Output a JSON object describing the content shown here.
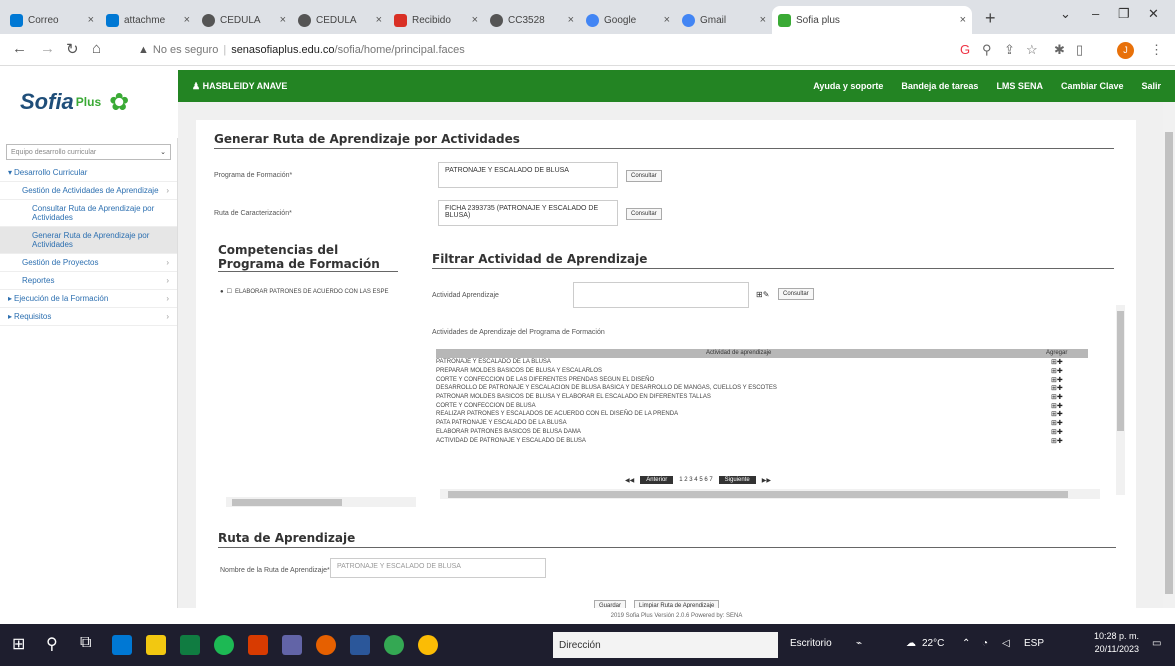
{
  "browser": {
    "tabs": [
      {
        "label": "Correo",
        "favicon_color": "#0078d4"
      },
      {
        "label": "attachme",
        "favicon_color": "#0078d4"
      },
      {
        "label": "CEDULA",
        "favicon_color": "#555555"
      },
      {
        "label": "CEDULA",
        "favicon_color": "#555555"
      },
      {
        "label": "Recibido",
        "favicon_color": "#d93025"
      },
      {
        "label": "CC3528",
        "favicon_color": "#555555"
      },
      {
        "label": "Google",
        "favicon_color": "#4285f4"
      },
      {
        "label": "Gmail",
        "favicon_color": "#4285f4"
      },
      {
        "label": "Sofia plus",
        "favicon_color": "#3aaa35"
      }
    ],
    "url_prefix": "No es seguro",
    "url_host": "senasofiaplus.edu.co",
    "url_path": "/sofia/home/principal.faces",
    "profile_initial": "J"
  },
  "header": {
    "logo_text": "Sofia",
    "logo_plus": "Plus",
    "user_name": "HASBLEIDY ANAVE",
    "links": [
      "Ayuda y soporte",
      "Bandeja de tareas",
      "LMS SENA",
      "Cambiar Clave",
      "Salir"
    ]
  },
  "sidebar": {
    "role_placeholder": "Equipo desarrollo curricular",
    "items": [
      {
        "label": "Desarrollo Curricular",
        "level": 0
      },
      {
        "label": "Gestión de Actividades de Aprendizaje",
        "level": 1
      },
      {
        "label": "Consultar Ruta de Aprendizaje por Actividades",
        "level": 2
      },
      {
        "label": "Generar Ruta de Aprendizaje por Actividades",
        "level": 2
      },
      {
        "label": "Gestión de Proyectos",
        "level": 1
      },
      {
        "label": "Reportes",
        "level": 1
      },
      {
        "label": "Ejecución de la Formación",
        "level": 0
      },
      {
        "label": "Requisitos",
        "level": 0
      }
    ]
  },
  "form": {
    "title": "Generar Ruta de Aprendizaje por Actividades",
    "programa_label": "Programa de Formación*",
    "programa_value": "PATRONAJE Y ESCALADO DE BLUSA",
    "programa_btn": "Consultar",
    "ruta_label": "Ruta de Caracterización*",
    "ruta_value": "FICHA 2393735 (PATRONAJE Y ESCALADO DE BLUSA)",
    "ruta_btn": "Consultar"
  },
  "competencias": {
    "title": "Competencias del Programa de Formación",
    "item": "ELABORAR PATRONES DE ACUERDO CON LAS ESPE"
  },
  "filtro": {
    "title": "Filtrar Actividad de Aprendizaje",
    "actividad_label": "Actividad Aprendizaje",
    "consultar_btn": "Consultar",
    "list_caption": "Actividades de Aprendizaje del Programa de Formación",
    "col_actividad": "Actividad de aprendizaje",
    "col_agregar": "Agregar",
    "rows": [
      "PATRONAJE Y ESCALADO DE LA BLUSA",
      "PREPARAR MOLDES BASICOS DE BLUSA Y ESCALARLOS",
      "CORTE Y CONFECCION DE LAS DIFERENTES PRENDAS SEGUN EL DISEÑO",
      "DESARROLLO DE PATRONAJE Y ESCALACION DE BLUSA BASICA Y DESARROLLO DE MANGAS, CUELLOS Y ESCOTES",
      "PATRONAR MOLDES BASICOS DE BLUSA Y ELABORAR EL ESCALADO EN DIFERENTES TALLAS",
      "CORTE Y CONFECCION DE BLUSA",
      "REALIZAR PATRONES Y ESCALADOS DE ACUERDO CON EL DISEÑO DE LA PRENDA",
      "PATA PATRONAJE Y ESCALADO DE LA BLUSA",
      "ELABORAR PATRONES BASICOS DE BLUSA DAMA",
      "ACTIVIDAD DE PATRONAJE Y ESCALADO DE BLUSA"
    ],
    "pager_prev": "Anterior",
    "pager_pages": "1 2 3 4 5 6 7",
    "pager_next": "Siguiente"
  },
  "ruta": {
    "title": "Ruta de Aprendizaje",
    "nombre_label": "Nombre de la Ruta de Aprendizaje*",
    "nombre_value": "PATRONAJE Y ESCALADO DE BLUSA",
    "btn_guardar": "Guardar",
    "btn_limpiar": "Limpiar Ruta de Aprendizaje"
  },
  "footer": "2019 Sofia Plus Versión 2.0.6 Powered by: SENA",
  "taskbar": {
    "search_text": "Dirección",
    "weather": "22°C",
    "lang": "ESP",
    "time": "10:28 p. m.",
    "date": "20/11/2023",
    "desktop_label": "Escritorio"
  }
}
